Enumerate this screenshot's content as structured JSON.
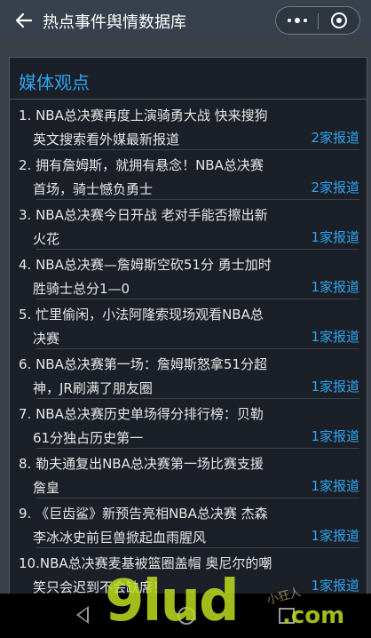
{
  "header": {
    "title": "热点事件舆情数据库",
    "back_icon": "arrow-left-icon",
    "more_icon": "more-dots-icon",
    "close_icon": "target-close-icon"
  },
  "section": {
    "title": "媒体观点"
  },
  "items": [
    {
      "line1": "1. NBA总决赛再度上演骑勇大战 快来搜狗",
      "line2": "英文搜索看外媒最新报道",
      "count": "2家报道"
    },
    {
      "line1": "2. 拥有詹姆斯，就拥有悬念！NBA总决赛",
      "line2": "首场，骑士憾负勇士",
      "count": "2家报道"
    },
    {
      "line1": "3. NBA总决赛今日开战 老对手能否擦出新",
      "line2": "火花",
      "count": "1家报道"
    },
    {
      "line1": "4. NBA总决赛—詹姆斯空砍51分 勇士加时",
      "line2": "胜骑士总分1—0",
      "count": "1家报道"
    },
    {
      "line1": "5. 忙里偷闲，小法阿隆索现场观看NBA总",
      "line2": "决赛",
      "count": "1家报道"
    },
    {
      "line1": "6. NBA总决赛第一场：詹姆斯怒拿51分超",
      "line2": "神，JR刷满了朋友圈",
      "count": "1家报道"
    },
    {
      "line1": "7. NBA总决赛历史单场得分排行榜：贝勒",
      "line2": "61分独占历史第一",
      "count": "1家报道"
    },
    {
      "line1": "8. 勒夫通复出NBA总决赛第一场比赛支援",
      "line2": "詹皇",
      "count": "1家报道"
    },
    {
      "line1": "9. 《巨齿鲨》新预告亮相NBA总决赛 杰森",
      "line2": "李冰冰史前巨兽掀起血雨腥风",
      "count": "1家报道"
    },
    {
      "line1": "10.NBA总决赛麦基被篮圈盖帽 奥尼尔的嘲",
      "line2": "笑只会迟到不会缺席！",
      "count": "1家报道"
    }
  ],
  "system_nav": {
    "back_icon": "nav-back-triangle-icon",
    "home_icon": "nav-home-circle-icon",
    "recent_icon": "nav-recent-square-icon"
  },
  "watermark": {
    "main": "9lud",
    "com": ".com",
    "small": "小狂人"
  },
  "colors": {
    "accent": "#2ba4ef",
    "panel_bg": "#1b2028",
    "page_bg": "#3a3f48"
  }
}
